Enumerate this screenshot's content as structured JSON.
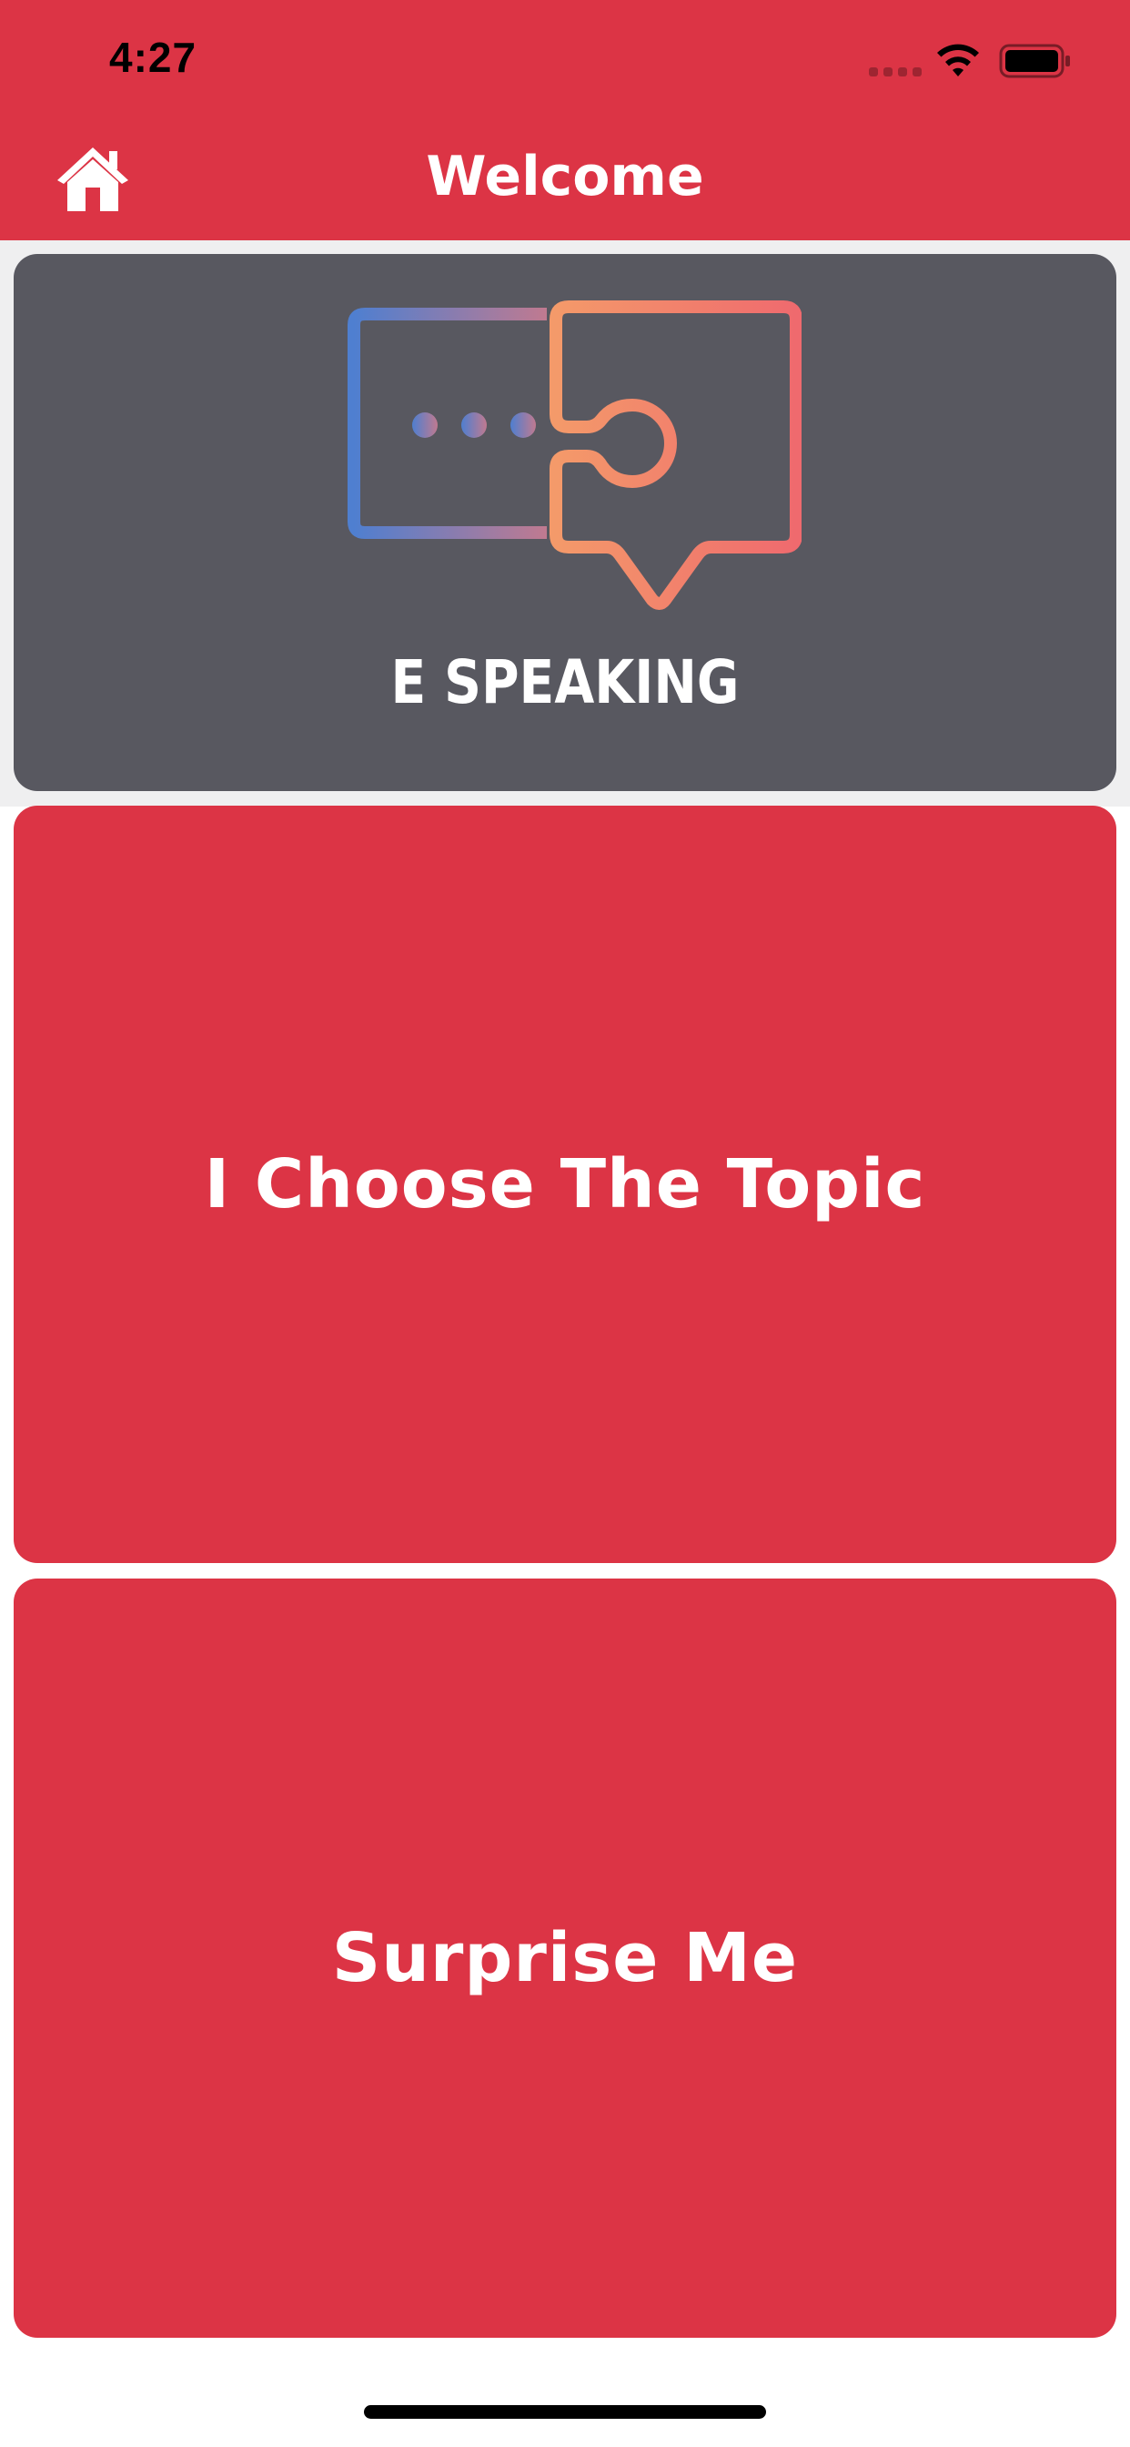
{
  "status_bar": {
    "time": "4:27"
  },
  "nav_bar": {
    "title": "Welcome",
    "home_icon": "home-icon"
  },
  "logo": {
    "text": "E SPEAKING",
    "icon": "chat-puzzle-logo"
  },
  "actions": {
    "choose_topic_label": "I Choose The Topic",
    "surprise_me_label": "Surprise Me"
  },
  "colors": {
    "primary_red": "#dc3445",
    "logo_card_gray": "#585860",
    "background_light": "#efeff0",
    "logo_gradient_blue": "#4f7fd0",
    "logo_gradient_orange": "#f49a6a",
    "logo_gradient_red": "#ef6a6e"
  }
}
